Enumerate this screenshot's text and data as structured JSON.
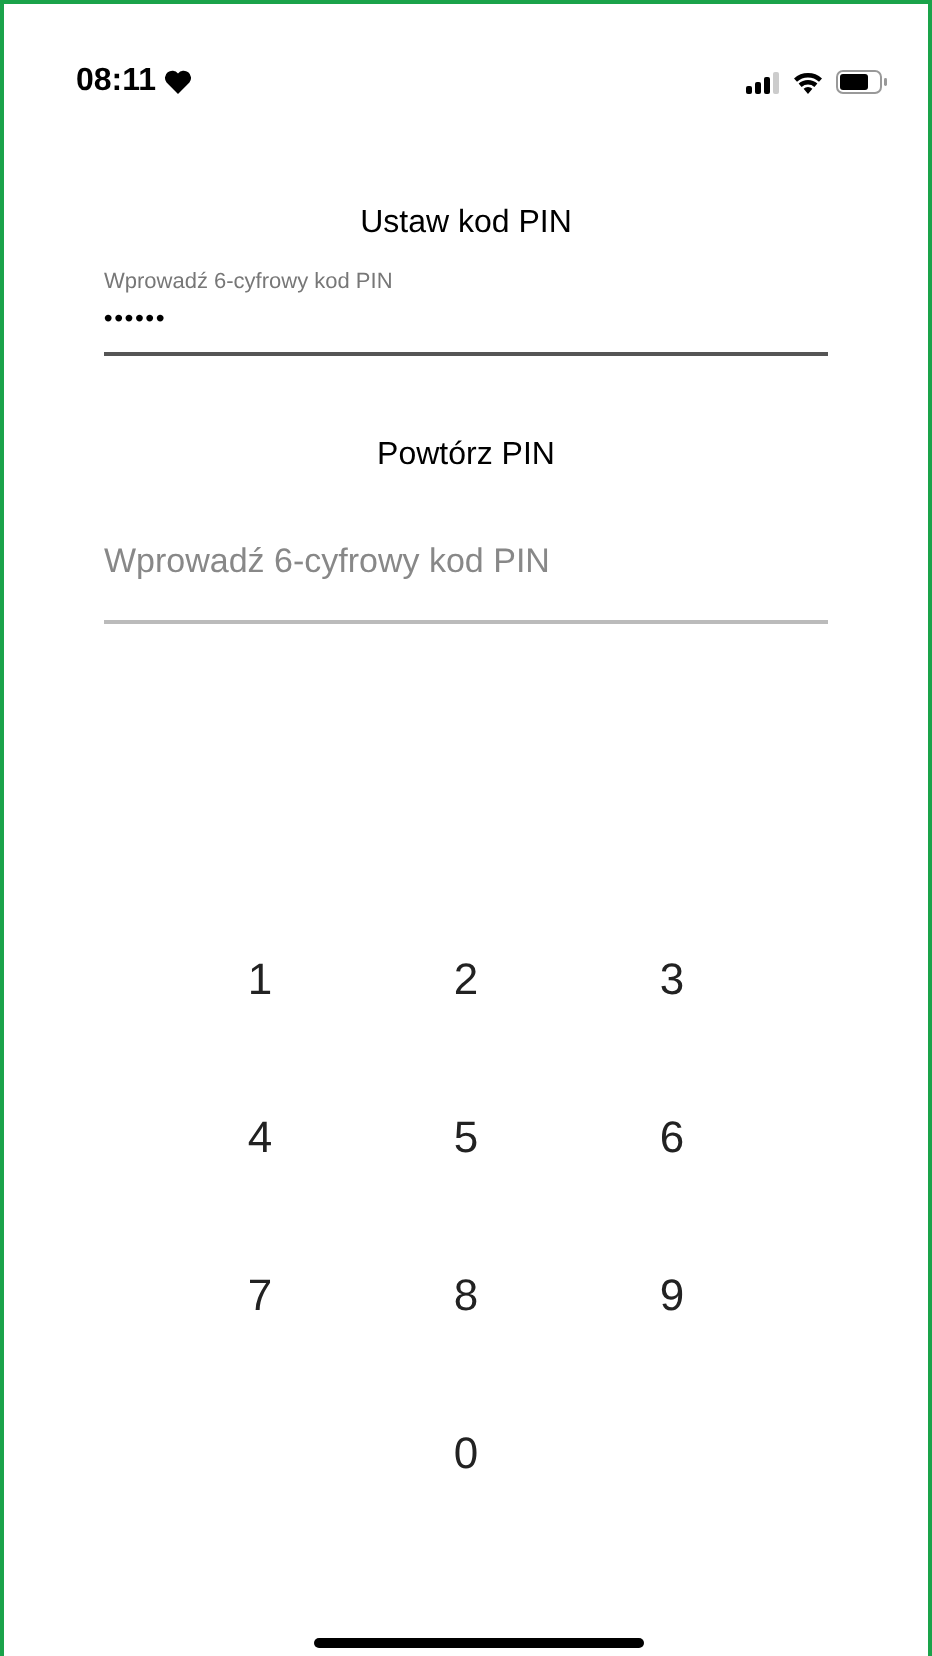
{
  "status_bar": {
    "time": "08:11"
  },
  "pin_setup": {
    "title": "Ustaw kod PIN",
    "field": {
      "label": "Wprowadź 6-cyfrowy kod PIN",
      "value": "••••••",
      "focused": true
    }
  },
  "pin_repeat": {
    "title": "Powtórz PIN",
    "field": {
      "placeholder": "Wprowadź 6-cyfrowy kod PIN",
      "focused": false
    }
  },
  "keypad": {
    "rows": [
      [
        "1",
        "2",
        "3"
      ],
      [
        "4",
        "5",
        "6"
      ],
      [
        "7",
        "8",
        "9"
      ],
      [
        "",
        "0",
        ""
      ]
    ]
  }
}
